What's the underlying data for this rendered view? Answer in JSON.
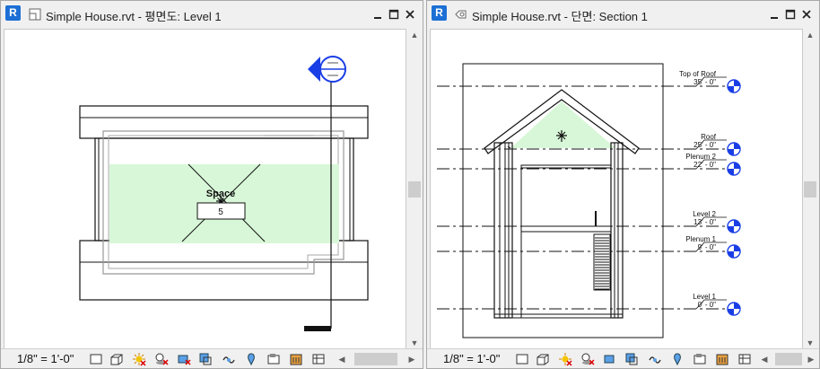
{
  "left_view": {
    "app_badge": "R",
    "title": "Simple House.rvt - 평면도: Level 1",
    "space_label": "Space",
    "space_number": "5",
    "scale": "1/8\" = 1'-0\"",
    "view_icon": "floor-plan-view-icon"
  },
  "right_view": {
    "app_badge": "R",
    "title": "Simple House.rvt - 단면: Section 1",
    "scale": "1/8\" = 1'-0\"",
    "view_icon": "section-view-icon",
    "levels": [
      {
        "name": "Top of Roof",
        "elevation": "35' - 0\""
      },
      {
        "name": "Roof",
        "elevation": "25' - 0\""
      },
      {
        "name": "Plenum 2",
        "elevation": "22' - 0\""
      },
      {
        "name": "Level 2",
        "elevation": "13' - 0\""
      },
      {
        "name": "Plenum 1",
        "elevation": "9' - 0\""
      },
      {
        "name": "Level 1",
        "elevation": "0' - 0\""
      }
    ]
  },
  "window_controls": [
    "minimize-icon",
    "maximize-icon",
    "close-icon"
  ],
  "colors": {
    "space_fill": "#d8f7d8",
    "level_head": "#1a3ee6",
    "section_marker": "#1a3ee6",
    "app_icon": "#1c6fd4"
  }
}
